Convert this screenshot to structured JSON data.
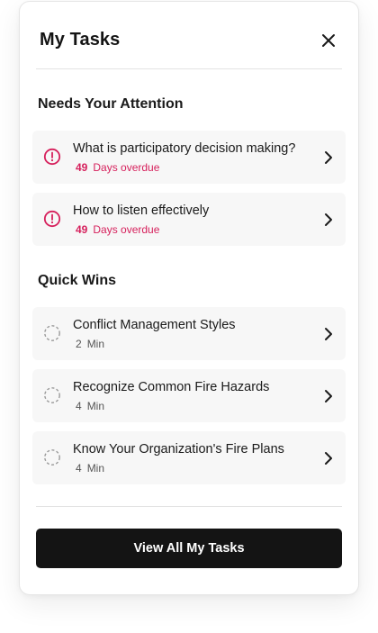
{
  "header": {
    "title": "My Tasks",
    "close_icon": "close-icon"
  },
  "sections": {
    "attention": {
      "title": "Needs Your Attention",
      "items": [
        {
          "title": "What is participatory decision making?",
          "value": "49",
          "label": "Days overdue",
          "icon": "alert-circle-icon"
        },
        {
          "title": "How to listen effectively",
          "value": "49",
          "label": "Days overdue",
          "icon": "alert-circle-icon"
        }
      ]
    },
    "quick_wins": {
      "title": "Quick Wins",
      "items": [
        {
          "title": "Conflict Management Styles",
          "value": "2",
          "label": "Min",
          "icon": "dashed-circle-icon"
        },
        {
          "title": "Recognize Common Fire Hazards",
          "value": "4",
          "label": "Min",
          "icon": "dashed-circle-icon"
        },
        {
          "title": "Know Your Organization's Fire Plans",
          "value": "4",
          "label": "Min",
          "icon": "dashed-circle-icon"
        }
      ]
    }
  },
  "footer": {
    "button_label": "View All My Tasks"
  },
  "colors": {
    "overdue": "#d6205c",
    "button_bg": "#141414",
    "card_bg": "#f7f7f7"
  }
}
